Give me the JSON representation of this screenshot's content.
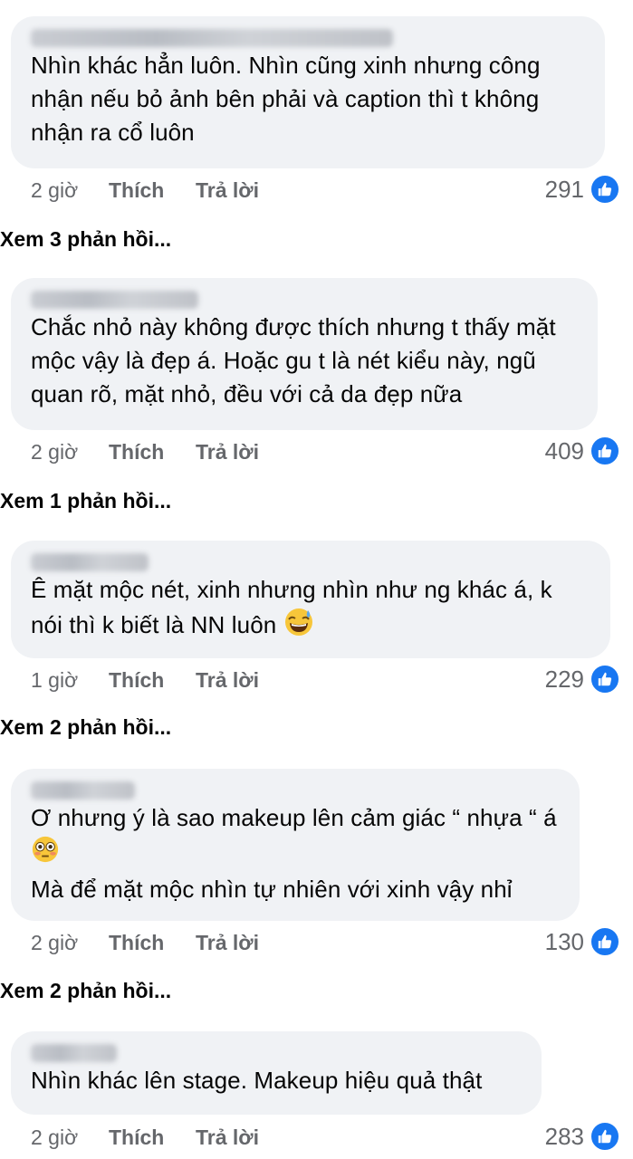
{
  "comments": [
    {
      "text": "Nhìn khác hẳn luôn. Nhìn cũng xinh nhưng công nhận nếu bỏ ảnh bên phải và caption thì t không nhận ra cổ luôn",
      "time": "2 giờ",
      "like": "Thích",
      "reply": "Trả lời",
      "reactions": "291",
      "view_replies": "Xem 3 phản hồi..."
    },
    {
      "text": "Chắc nhỏ này không được thích nhưng t thấy mặt mộc vậy là đẹp á. Hoặc gu t là nét kiểu này, ngũ quan rõ, mặt nhỏ, đều với cả da đẹp nữa",
      "time": "2 giờ",
      "like": "Thích",
      "reply": "Trả lời",
      "reactions": "409",
      "view_replies": "Xem 1 phản hồi..."
    },
    {
      "text": "Ê mặt mộc nét, xinh nhưng nhìn như ng khác á, k nói thì k biết là NN luôn",
      "emoji": "grinning-sweat-emoji",
      "time": "1 giờ",
      "like": "Thích",
      "reply": "Trả lời",
      "reactions": "229",
      "view_replies": "Xem 2 phản hồi..."
    },
    {
      "text": "Ơ nhưng ý là sao makeup lên cảm giác “ nhựa “ á",
      "emoji": "flushed-emoji",
      "text2": "Mà để mặt mộc nhìn tự nhiên với xinh vậy nhỉ",
      "time": "2 giờ",
      "like": "Thích",
      "reply": "Trả lời",
      "reactions": "130",
      "view_replies": "Xem 2 phản hồi..."
    },
    {
      "text": "Nhìn khác lên stage. Makeup hiệu quả thật",
      "time": "2 giờ",
      "like": "Thích",
      "reply": "Trả lời",
      "reactions": "283"
    }
  ],
  "colors": {
    "bubble": "#f0f2f5",
    "meta": "#65676b",
    "like_blue": "#1877f2"
  }
}
